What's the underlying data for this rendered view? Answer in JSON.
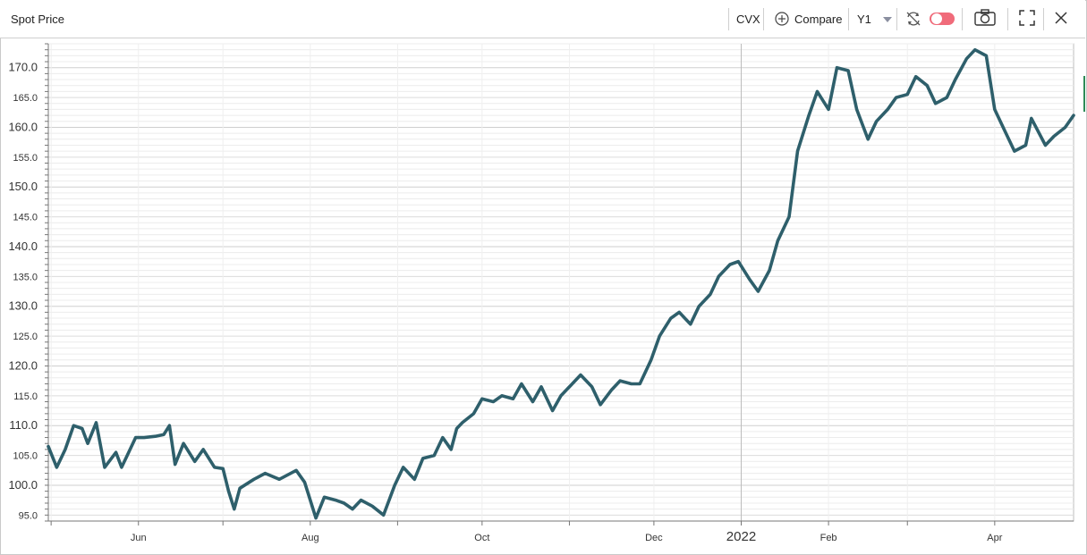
{
  "header": {
    "title": "Spot Price",
    "ticker": "CVX",
    "compare_label": "Compare",
    "range_label": "Y1"
  },
  "icons": [
    "compare-plus-icon",
    "chevron-down-icon",
    "sync-off-icon",
    "toggle-switch",
    "camera-icon",
    "fullscreen-icon",
    "close-icon"
  ],
  "colors": {
    "line": "#2e5f6b",
    "toggle": "#f06b7a",
    "grid_major": "#cfcfcf",
    "grid_minor": "#ececec"
  },
  "chart_data": {
    "type": "line",
    "title": "",
    "xlabel": "",
    "ylabel": "",
    "ylim": [
      94,
      174
    ],
    "y_ticks": [
      "95.0",
      "100.0",
      "105.0",
      "110.0",
      "115.0",
      "120.0",
      "125.0",
      "130.0",
      "135.0",
      "140.0",
      "145.0",
      "150.0",
      "155.0",
      "160.0",
      "165.0",
      "170.0"
    ],
    "x_ticks": [
      {
        "label": "Jun",
        "date": "2021-06-01",
        "major": false
      },
      {
        "label": "Aug",
        "date": "2021-08-01",
        "major": false
      },
      {
        "label": "Oct",
        "date": "2021-10-01",
        "major": false
      },
      {
        "label": "Dec",
        "date": "2021-12-01",
        "major": false
      },
      {
        "label": "2022",
        "date": "2022-01-01",
        "major": true
      },
      {
        "label": "Feb",
        "date": "2022-02-01",
        "major": false
      },
      {
        "label": "Apr",
        "date": "2022-04-01",
        "major": false
      }
    ],
    "x_range": [
      "2021-04-30",
      "2022-04-29"
    ],
    "series": [
      {
        "x": [
          "2021-04-30",
          "2021-05-03",
          "2021-05-06",
          "2021-05-09",
          "2021-05-12",
          "2021-05-14",
          "2021-05-17",
          "2021-05-20",
          "2021-05-24",
          "2021-05-26",
          "2021-05-28",
          "2021-05-31",
          "2021-06-03",
          "2021-06-07",
          "2021-06-10",
          "2021-06-12",
          "2021-06-14",
          "2021-06-17",
          "2021-06-21",
          "2021-06-24",
          "2021-06-28",
          "2021-07-01",
          "2021-07-03",
          "2021-07-05",
          "2021-07-07",
          "2021-07-12",
          "2021-07-16",
          "2021-07-21",
          "2021-07-27",
          "2021-07-30",
          "2021-08-03",
          "2021-08-06",
          "2021-08-10",
          "2021-08-13",
          "2021-08-16",
          "2021-08-19",
          "2021-08-23",
          "2021-08-27",
          "2021-08-31",
          "2021-09-03",
          "2021-09-07",
          "2021-09-10",
          "2021-09-14",
          "2021-09-17",
          "2021-09-20",
          "2021-09-22",
          "2021-09-24",
          "2021-09-28",
          "2021-10-01",
          "2021-10-05",
          "2021-10-08",
          "2021-10-12",
          "2021-10-15",
          "2021-10-19",
          "2021-10-22",
          "2021-10-26",
          "2021-10-29",
          "2021-11-02",
          "2021-11-05",
          "2021-11-09",
          "2021-11-12",
          "2021-11-16",
          "2021-11-19",
          "2021-11-23",
          "2021-11-26",
          "2021-11-30",
          "2021-12-03",
          "2021-12-07",
          "2021-12-10",
          "2021-12-14",
          "2021-12-17",
          "2021-12-21",
          "2021-12-24",
          "2021-12-28",
          "2021-12-31",
          "2022-01-04",
          "2022-01-07",
          "2022-01-11",
          "2022-01-14",
          "2022-01-18",
          "2022-01-21",
          "2022-01-25",
          "2022-01-28",
          "2022-02-01",
          "2022-02-04",
          "2022-02-08",
          "2022-02-11",
          "2022-02-15",
          "2022-02-18",
          "2022-02-22",
          "2022-02-25",
          "2022-03-01",
          "2022-03-04",
          "2022-03-08",
          "2022-03-11",
          "2022-03-15",
          "2022-03-18",
          "2022-03-22",
          "2022-03-25",
          "2022-03-29",
          "2022-04-01",
          "2022-04-05",
          "2022-04-08",
          "2022-04-12",
          "2022-04-14",
          "2022-04-19",
          "2022-04-22",
          "2022-04-26",
          "2022-04-29"
        ],
        "values": [
          106.5,
          103.0,
          106.0,
          110.0,
          109.5,
          107.0,
          110.5,
          103.0,
          105.5,
          103.0,
          105.0,
          108.0,
          108.0,
          108.2,
          108.5,
          110.0,
          103.5,
          107.0,
          104.0,
          106.0,
          103.0,
          102.8,
          99.0,
          96.0,
          99.5,
          101.0,
          102.0,
          101.0,
          102.5,
          100.5,
          94.5,
          98.0,
          97.5,
          97.0,
          96.0,
          97.5,
          96.5,
          95.0,
          100.0,
          103.0,
          101.0,
          104.5,
          105.0,
          108.0,
          106.0,
          109.5,
          110.5,
          112.0,
          114.5,
          114.0,
          115.0,
          114.5,
          117.0,
          114.0,
          116.5,
          112.5,
          115.0,
          117.0,
          118.5,
          116.5,
          113.5,
          116.0,
          117.5,
          117.0,
          117.0,
          121.0,
          125.0,
          128.0,
          129.0,
          127.0,
          130.0,
          132.0,
          135.0,
          137.0,
          137.5,
          134.5,
          132.5,
          136.0,
          141.0,
          145.0,
          156.0,
          162.0,
          166.0,
          163.0,
          170.0,
          169.5,
          163.0,
          158.0,
          161.0,
          163.0,
          165.0,
          165.5,
          168.5,
          167.0,
          164.0,
          165.0,
          168.0,
          171.5,
          173.0,
          172.0,
          163.0,
          159.0,
          156.0,
          157.0,
          161.5,
          157.0,
          158.5,
          160.0,
          162.0
        ],
        "values_note": ""
      }
    ]
  }
}
